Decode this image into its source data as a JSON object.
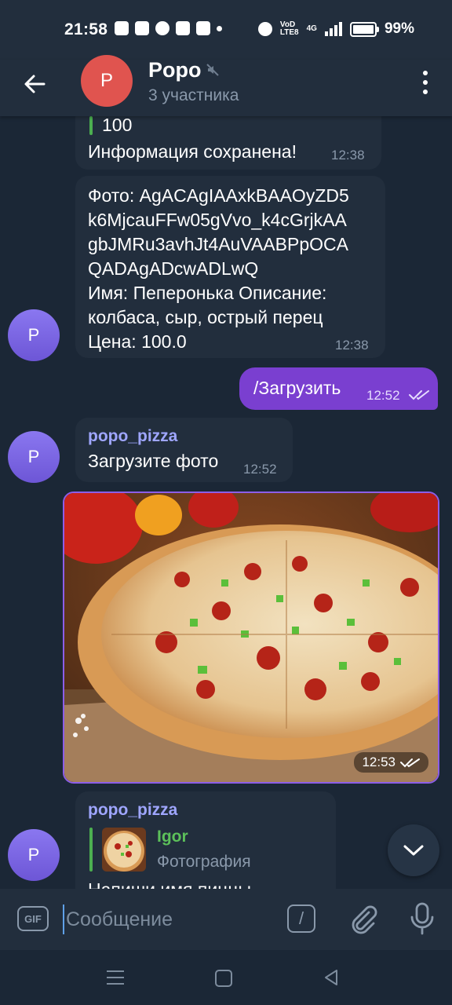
{
  "status": {
    "time": "21:58",
    "net_top": "VoD",
    "net_bottom": "LTE8",
    "net_g": "4G",
    "battery": "99%"
  },
  "header": {
    "avatar_letter": "P",
    "title": "Popo",
    "subtitle": "3 участника"
  },
  "messages": {
    "m1": {
      "quote": "100",
      "text": "Информация сохранена!",
      "time": "12:38"
    },
    "m2": {
      "lines": [
        "Фото: AgACAgIAAxkBAAOyZD5",
        "k6MjcauFFw05gVvo_k4cGrjkAA",
        "gbJMRu3avhJt4AuVAABPpOCA",
        "QADAgADcwADLwQ",
        "Имя: Пеперонька Описание:",
        "колбаса, сыр, острый перец",
        "Цена: 100.0"
      ],
      "time": "12:38",
      "avatar_letter": "P"
    },
    "m3": {
      "text": "/Загрузить",
      "time": "12:52"
    },
    "m4": {
      "sender": "popo_pizza",
      "text": "Загрузите фото",
      "time": "12:52",
      "avatar_letter": "P"
    },
    "m5": {
      "time": "12:53"
    },
    "m6": {
      "sender": "popo_pizza",
      "reply_name": "Igor",
      "reply_text": "Фотография",
      "text": "Напиши имя пиццы",
      "avatar_letter": "P"
    }
  },
  "input": {
    "placeholder": "Сообщение",
    "gif_label": "GIF",
    "slash_label": "/"
  },
  "colors": {
    "background": "#1b2736",
    "bar": "#222e3d",
    "bubble_in": "#222e3d",
    "bubble_out": "#7a3fd0",
    "sender": "#9fa6ff",
    "accent_purple": "#8c5ee8",
    "quote_bar": "#4caf50",
    "header_avatar": "#e0544f"
  }
}
